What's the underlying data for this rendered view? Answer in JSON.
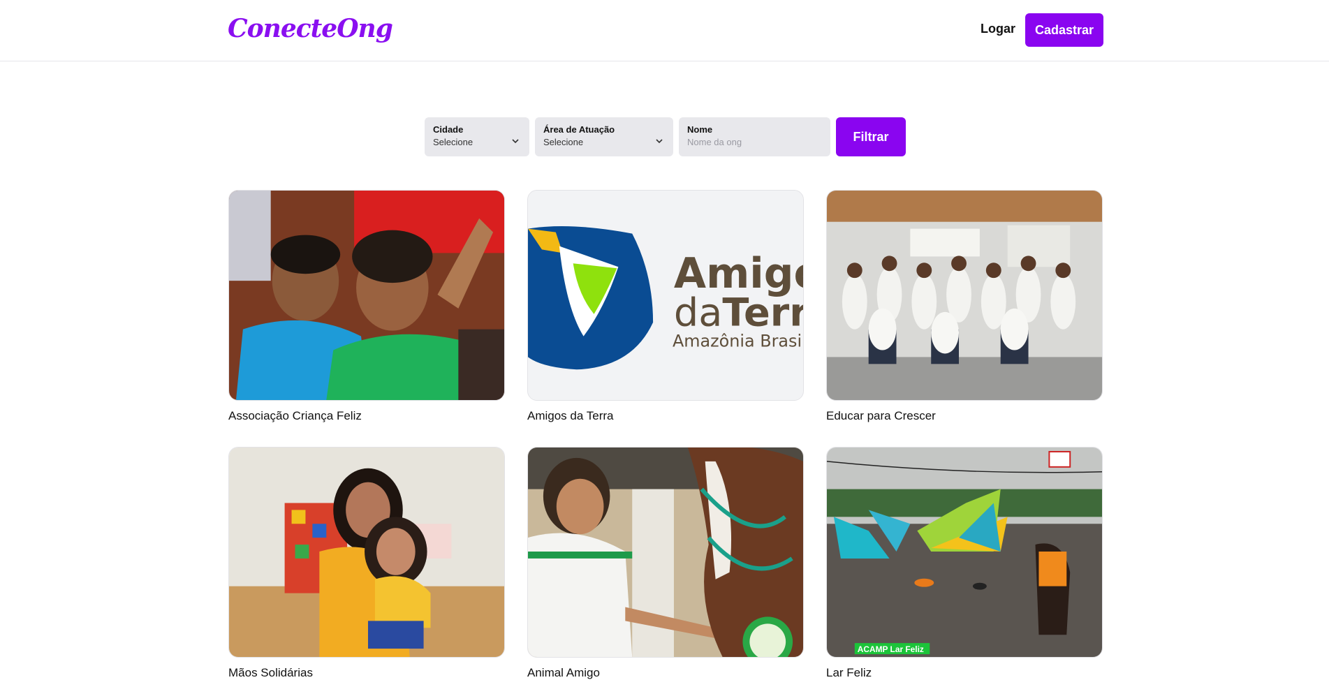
{
  "header": {
    "logo": "ConecteOng",
    "login_label": "Logar",
    "signup_label": "Cadastrar"
  },
  "filters": {
    "city": {
      "label": "Cidade",
      "value": "Selecione"
    },
    "area": {
      "label": "Área de Atuação",
      "value": "Selecione"
    },
    "name": {
      "label": "Nome",
      "placeholder": "Nome da ong"
    },
    "submit_label": "Filtrar"
  },
  "ongs": [
    {
      "name": "Associação Criança Feliz",
      "image": "children-smiling-photo"
    },
    {
      "name": "Amigos da Terra",
      "image": "amigos-da-terra-logo",
      "logo_line1": "Amigo",
      "logo_line2a": "da",
      "logo_line2b": "Terra",
      "logo_line3": "Amazônia Brasile"
    },
    {
      "name": "Educar para Crescer",
      "image": "group-volunteers-photo"
    },
    {
      "name": "Mãos Solidárias",
      "image": "girls-hugging-photo"
    },
    {
      "name": "Animal Amigo",
      "image": "boy-feeding-horse-photo"
    },
    {
      "name": "Lar Feliz",
      "image": "water-park-photo",
      "overlay_text": "ACAMP Lar Feliz"
    }
  ],
  "colors": {
    "brand": "#8a05f0",
    "input_bg": "#e8e8ec"
  }
}
